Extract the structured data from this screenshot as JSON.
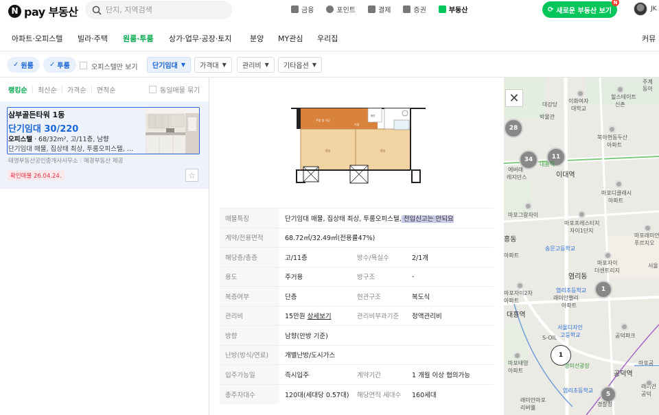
{
  "header": {
    "logo_mark": "N",
    "brand": "pay 부동산",
    "search_placeholder": "단지, 지역검색",
    "services": [
      {
        "label": "금융",
        "icon": "finance-icon",
        "active": false
      },
      {
        "label": "포인트",
        "icon": "point-icon",
        "active": false
      },
      {
        "label": "결제",
        "icon": "payment-icon",
        "active": false
      },
      {
        "label": "증권",
        "icon": "stock-icon",
        "active": false
      },
      {
        "label": "부동산",
        "icon": "realestate-icon",
        "active": true
      }
    ],
    "new_button": "새로운 부동산 보기",
    "new_badge": "N",
    "user": "JK"
  },
  "categories": [
    {
      "label": "아파트·오피스텔",
      "active": false
    },
    {
      "label": "빌라·주택",
      "active": false
    },
    {
      "label": "원룸·투룸",
      "active": true
    },
    {
      "label": "상가·업무·공장·토지",
      "active": false
    },
    {
      "label": "분양",
      "active": false
    },
    {
      "label": "MY관심",
      "active": false
    },
    {
      "label": "우리집",
      "active": false
    },
    {
      "label": "커뮤",
      "active": false
    }
  ],
  "filters": {
    "chip_one": "원룸",
    "chip_two": "투룸",
    "officetel_only": "오피스텔만 보기",
    "deal_type": "단기임대",
    "price": "가격대",
    "maintenance": "관리비",
    "other": "기타옵션"
  },
  "sorts": [
    "랭킹순",
    "최신순",
    "가격순",
    "면적순"
  ],
  "same_listing": "동일매물 묶기",
  "listing": {
    "title": "삼부골든타워 1동",
    "price": "단기임대 30/220",
    "type": "오피스텔",
    "spec": "68/32m², 고/11층, 남향",
    "desc": "단기임대 매물, 집상태 최상, 투룸오피스텔, …",
    "agent": "태영부동산공인중개사사무소",
    "provider": "매경부동산 제공",
    "confirmed": "확인매물 26.04.24."
  },
  "details": {
    "feature_label": "매물특징",
    "feature_value": "단기임대 매물, 집상태 최상, 투룸오피스텔,",
    "feature_highlight": " 전입신고는 안되요",
    "area_label": "계약/전용면적",
    "area_value": "68.72㎡/32.49㎡(전용률47%)",
    "floor_label": "해당층/총층",
    "floor_value": "고/11층",
    "rooms_label": "방수/욕실수",
    "rooms_value": "2/1개",
    "use_label": "용도",
    "use_value": "주거용",
    "struct_label": "방구조",
    "struct_value": "-",
    "duplex_label": "복층여부",
    "duplex_value": "단층",
    "entrance_label": "현관구조",
    "entrance_value": "복도식",
    "fee_label": "관리비",
    "fee_value": "15만원",
    "fee_link": "상세보기",
    "fee_basis_label": "관리비부과기준",
    "fee_basis_value": "정액관리비",
    "direction_label": "방향",
    "direction_value": "남향(안방 기준)",
    "heating_label": "난방(방식/연료)",
    "heating_value": "개별난방/도시가스",
    "movein_label": "입주가능일",
    "movein_value": "즉시입주",
    "term_label": "계약기간",
    "term_value": "1 개월 이상 협의가능",
    "parking_label": "총주차대수",
    "parking_value": "120대(세대당 0.57대)",
    "units_label": "해당면적 세대수",
    "units_value": "160세대"
  },
  "floorplan_rooms": [
    "주방 및 식당",
    "거실",
    "현관",
    "침실",
    "침실"
  ],
  "map": {
    "labels": [
      "주계",
      "동아",
      "힐스테이트",
      "신촌",
      "대강당",
      "이화여자",
      "대학교",
      "박물관",
      "북아현동두산",
      "아파트",
      "에버래",
      "레지던스",
      "대흥역",
      "이대역",
      "마포그랑자이",
      "마포디클래시",
      "아파트",
      "마포프레스티지",
      "자이1단지",
      "마포래미안",
      "푸르지오",
      "흥동",
      "송문고등학교",
      "아파트",
      "마포자이",
      "더센트리지",
      "서울",
      "염리동",
      "마포자이2차",
      "아파트",
      "염리초등학교",
      "래미안밸리",
      "아파트",
      "대흥역",
      "서울디자인",
      "고등학교",
      "공덕파크",
      "S-OIL",
      "마포태영",
      "아파트",
      "경의선광장",
      "염리초등학교",
      "공덕역",
      "마포공",
      "래미안마포",
      "리버웰",
      "경찰청",
      "래미안",
      "공덕"
    ],
    "clusters": [
      "28",
      "34",
      "11",
      "1",
      "1",
      "5"
    ]
  },
  "colors": {
    "brand_green": "#03c75a",
    "link_blue": "#1a64d6",
    "alert_red": "#e03240"
  }
}
